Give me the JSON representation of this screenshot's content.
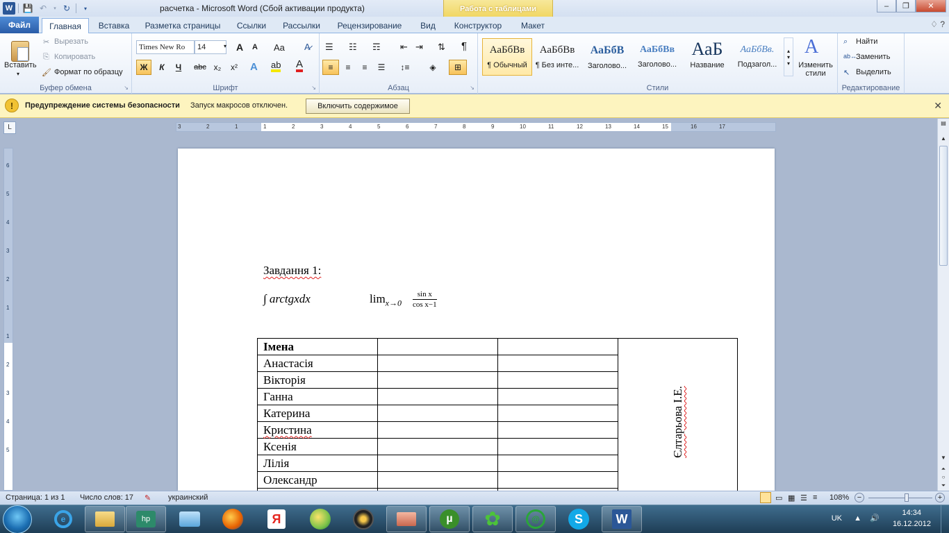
{
  "window": {
    "title": "расчетка - Microsoft Word (Сбой активации продукта)",
    "context_tab_header": "Работа с таблицами",
    "controls": [
      "–",
      "❐",
      "✕"
    ]
  },
  "tabs": {
    "file": "Файл",
    "items": [
      "Главная",
      "Вставка",
      "Разметка страницы",
      "Ссылки",
      "Рассылки",
      "Рецензирование",
      "Вид",
      "Конструктор",
      "Макет"
    ],
    "help": "♢ ?"
  },
  "ribbon": {
    "clipboard": {
      "paste": "Вставить",
      "cut": "Вырезать",
      "copy": "Копировать",
      "format_painter": "Формат по образцу",
      "label": "Буфер обмена"
    },
    "font": {
      "name": "Times New Ro",
      "size": "14",
      "label": "Шрифт",
      "grow": "A",
      "shrink": "A",
      "case": "Aa",
      "bold": "Ж",
      "italic": "К",
      "underline": "Ч",
      "strike": "abc",
      "sub": "x₂",
      "sup": "x²",
      "color": "A"
    },
    "paragraph": {
      "label": "Абзац",
      "pilcrow": "¶"
    },
    "styles": {
      "label": "Стили",
      "tiles": [
        {
          "sample": "АаБбВв",
          "name": "¶ Обычный"
        },
        {
          "sample": "АаБбВв",
          "name": "¶ Без инте..."
        },
        {
          "sample": "АаБбВ",
          "name": "Заголово..."
        },
        {
          "sample": "АаБбВв",
          "name": "Заголово..."
        },
        {
          "sample": "АаБ",
          "name": "Название"
        },
        {
          "sample": "АаБбВв.",
          "name": "Подзагол..."
        }
      ],
      "change_styles": "Изменить стили"
    },
    "editing": {
      "label": "Редактирование",
      "find": "Найти",
      "replace": "Заменить",
      "select": "Выделить"
    }
  },
  "security_bar": {
    "title": "Предупреждение системы безопасности",
    "message": "Запуск макросов отключен.",
    "button": "Включить содержимое"
  },
  "ruler": {
    "corner": "L",
    "h_numbers": [
      "3",
      "2",
      "1",
      "1",
      "2",
      "3",
      "4",
      "5",
      "6",
      "7",
      "8",
      "9",
      "10",
      "11",
      "12",
      "13",
      "14",
      "15",
      "16",
      "17"
    ],
    "v_numbers": [
      "6",
      "5",
      "4",
      "3",
      "2",
      "1",
      "1",
      "2",
      "3",
      "4",
      "5"
    ]
  },
  "document": {
    "heading": "Завдання 1:",
    "formula_integral": "∫ arctgxdx",
    "formula_lim": "lim",
    "formula_lim_sub": "x→0",
    "formula_num": "sin x",
    "formula_den": "cos x−1",
    "table_header": "Імена",
    "names": [
      "Анастасія",
      "Вікторія",
      "Ганна",
      "Катерина",
      "Кристина",
      "Ксенія",
      "Лілія",
      "Олександр"
    ],
    "rotated_text": "Єлтарьова І.Е."
  },
  "status": {
    "page": "Страница: 1 из 1",
    "words": "Число слов: 17",
    "language": "украинский",
    "zoom": "108%",
    "zoom_level": 0.6
  },
  "taskbar": {
    "lang": "UK",
    "time": "14:34",
    "date": "16.12.2012",
    "apps": [
      "ie-icon",
      "explorer-icon",
      "hp-icon",
      "mail-icon",
      "firefox-icon",
      "yandex-icon",
      "game-icon",
      "media-icon",
      "screenshot-icon",
      "utorrent-icon",
      "icq-icon",
      "agent-icon",
      "skype-icon",
      "word-icon"
    ]
  },
  "colors": {
    "accent": "#2b5797",
    "security_bar": "#fdf4bf",
    "context_tab": "#f0d560"
  }
}
